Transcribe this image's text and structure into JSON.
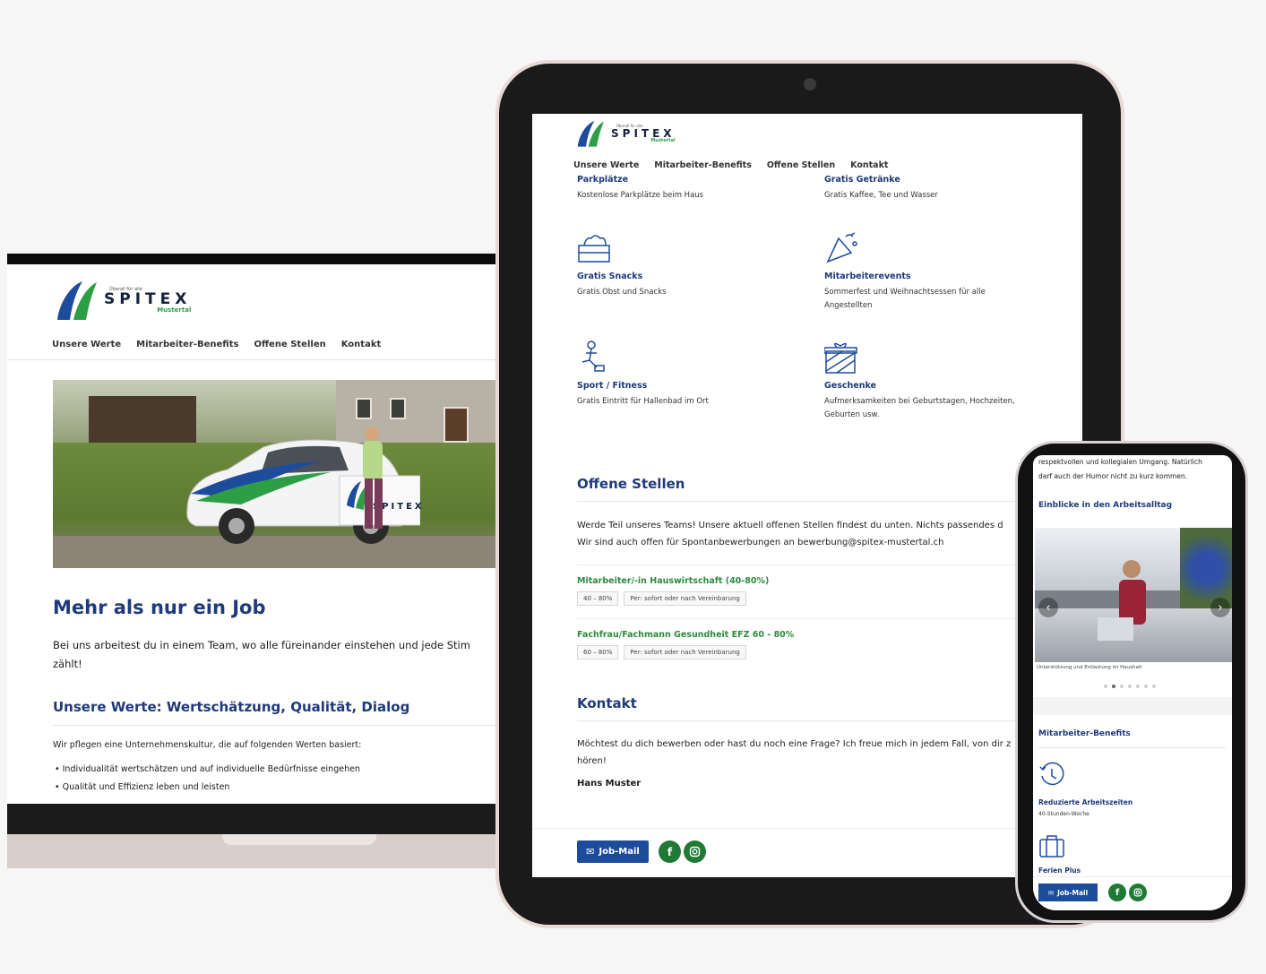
{
  "brand": {
    "tagline": "Überall für alle",
    "name": "SPITEX",
    "region": "Mustertal",
    "colors": {
      "blue": "#1e3a7b",
      "green": "#2e9e46",
      "button": "#1e4c9c"
    }
  },
  "nav": {
    "items": [
      "Unsere Werte",
      "Mitarbeiter-Benefits",
      "Offene Stellen",
      "Kontakt"
    ]
  },
  "laptop": {
    "heading": "Mehr als nur ein Job",
    "intro_line1": "Bei uns arbeitest du in einem Team, wo alle füreinander einstehen und jede Stim",
    "intro_line2": "zählt!",
    "values_heading": "Unsere Werte: Wertschätzung, Qualität, Dialog",
    "values_intro": "Wir pflegen eine Unternehmenskultur, die auf folgenden Werten basiert:",
    "values_list": [
      "Individualität wertschätzen und auf individuelle Bedürfnisse eingehen",
      "Qualität und Effizienz leben und leisten"
    ],
    "car_logo": "SPITEX"
  },
  "tablet": {
    "benefits": [
      {
        "icon": "parking-icon",
        "title": "Parkplätze",
        "text": "Kostenlose Parkplätze beim Haus"
      },
      {
        "icon": "drink-icon",
        "title": "Gratis Getränke",
        "text": "Gratis Kaffee, Tee und Wasser"
      },
      {
        "icon": "snack-icon",
        "title": "Gratis Snacks",
        "text": "Gratis Obst und Snacks"
      },
      {
        "icon": "party-icon",
        "title": "Mitarbeiterevents",
        "text": "Sommerfest und Weihnachtsessen für alle",
        "text2": "Angestellten"
      },
      {
        "icon": "fitness-icon",
        "title": "Sport / Fitness",
        "text": "Gratis Eintritt für Hallenbad im Ort"
      },
      {
        "icon": "gift-icon",
        "title": "Geschenke",
        "text": "Aufmerksamkeiten bei Geburtstagen, Hochzeiten,",
        "text2": "Geburten usw."
      }
    ],
    "jobs_heading": "Offene Stellen",
    "jobs_intro1": "Werde Teil unseres Teams! Unsere aktuell offenen Stellen findest du unten. Nichts passendes d",
    "jobs_intro2": "Wir sind auch offen für Spontanbewerbungen an bewerbung@spitex-mustertal.ch",
    "jobs": [
      {
        "title": "Mitarbeiter/-in Hauswirtschaft (40-80%)",
        "tags": [
          "40 – 80%",
          "Per: sofort oder nach Vereinbarung"
        ]
      },
      {
        "title": "Fachfrau/Fachmann Gesundheit EFZ 60 - 80%",
        "tags": [
          "60 – 80%",
          "Per: sofort oder nach Vereinbarung"
        ]
      }
    ],
    "contact_heading": "Kontakt",
    "contact_text1": "Möchtest du dich bewerben oder hast du noch eine Frage? Ich freue mich in jedem Fall, von dir z",
    "contact_text2": "hören!",
    "contact_name": "Hans Muster",
    "jobmail_label": "Job-Mail"
  },
  "phone": {
    "text1": "respektvollen und kollegialen Umgang. Natürlich",
    "text2": "darf auch der Humor nicht zu kurz kommen.",
    "insights_heading": "Einblicke in den Arbeitsalltag",
    "caption": "Unterstützung und Entlastung im Haushalt",
    "benefits_heading": "Mitarbeiter-Benefits",
    "benefit1_title": "Reduzierte Arbeitszeiten",
    "benefit1_text": "40-Stunden-Woche",
    "benefit2_title": "Ferien Plus",
    "jobmail_label": "Job-Mail",
    "carousel_total": 7,
    "carousel_active": 2
  }
}
